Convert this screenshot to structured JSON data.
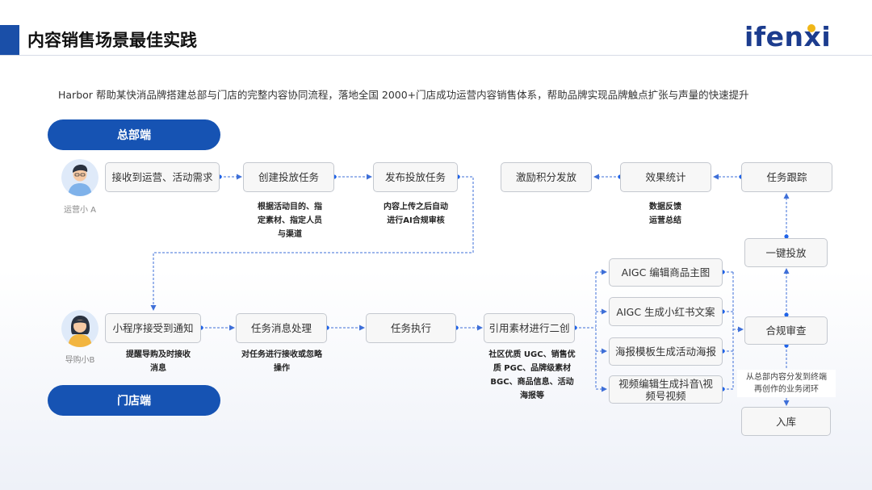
{
  "header": {
    "title": "内容销售场景最佳实践",
    "logo": "ifenxi"
  },
  "intro": "Harbor 帮助某快消品牌搭建总部与门店的完整内容协同流程，落地全国 2000+门店成功运营内容销售体系，帮助品牌实现品牌触点扩张与声量的快速提升",
  "sections": {
    "hq": "总部端",
    "store": "门店端"
  },
  "people": {
    "hq": "运营小 A",
    "store": "导购小B"
  },
  "hq_row": {
    "receive": "接收到运营、活动需求",
    "create": "创建投放任务",
    "publish": "发布投放任务",
    "reward": "激励积分发放",
    "stats": "效果统计",
    "track": "任务跟踪"
  },
  "hq_notes": {
    "create_l1": "根据活动目的、指",
    "create_l2": "定素材、指定人员",
    "create_l3": "与渠道",
    "publish_l1": "内容上传之后自动",
    "publish_l2": "进行AI合规审核",
    "stats_l1": "数据反馈",
    "stats_l2": "运营总结"
  },
  "store_row": {
    "notify": "小程序接受到通知",
    "process": "任务消息处理",
    "execute": "任务执行",
    "remix": "引用素材进行二创"
  },
  "store_notes": {
    "notify_l1": "提醒导购及时接收",
    "notify_l2": "消息",
    "process_l1": "对任务进行接收或忽略",
    "process_l2": "操作",
    "remix_l1": "社区优质 UGC、销售优",
    "remix_l2": "质 PGC、品牌级素材",
    "remix_l3": "BGC、商品信息、活动",
    "remix_l4": "海报等"
  },
  "aigc": {
    "main_image": "AIGC 编辑商品主图",
    "xhs": "AIGC 生成小红书文案",
    "poster": "海报模板生成活动海报",
    "video_l1": "视频编辑生成抖音\\视",
    "video_l2": "频号视频"
  },
  "right_col": {
    "launch": "一键投放",
    "review": "合规审查",
    "loop_l1": "从总部内容分发到终端",
    "loop_l2": "再创作的业务闭环",
    "archive": "入库"
  },
  "colors": {
    "brand": "#1653b3",
    "connector": "#3e6fd8",
    "logo_accent": "#f0b617"
  }
}
